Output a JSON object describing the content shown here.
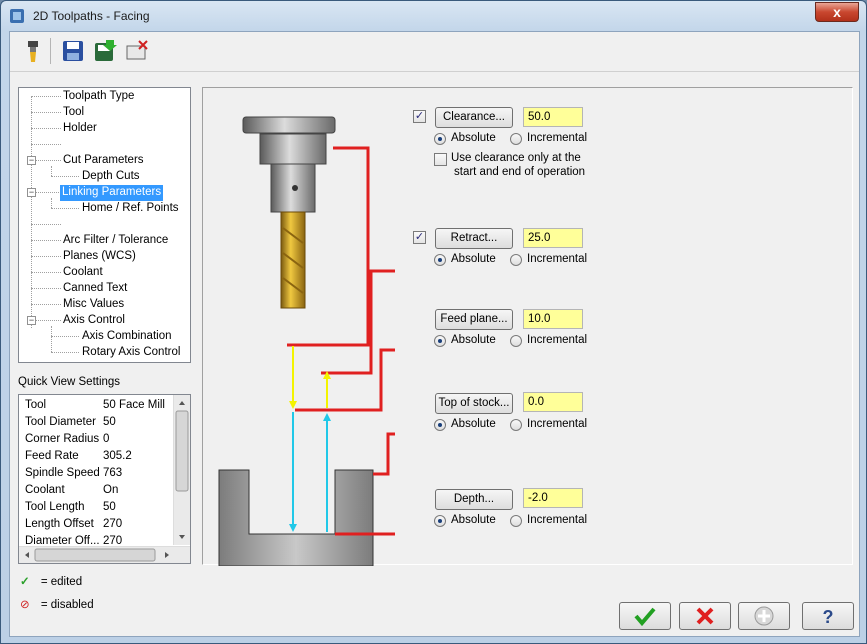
{
  "window": {
    "title": "2D Toolpaths - Facing",
    "close_symbol": "x"
  },
  "toolbar": {
    "icons": [
      "tool-icon",
      "save-icon",
      "save-to-library-icon",
      "disable-icon"
    ]
  },
  "tree": {
    "items": [
      {
        "label": "Toolpath Type"
      },
      {
        "label": "Tool"
      },
      {
        "label": "Holder"
      },
      {
        "label": ""
      },
      {
        "label": "Cut Parameters"
      },
      {
        "label": "Depth Cuts"
      },
      {
        "label": "Linking Parameters"
      },
      {
        "label": "Home / Ref. Points"
      },
      {
        "label": ""
      },
      {
        "label": "Arc Filter / Tolerance"
      },
      {
        "label": "Planes (WCS)"
      },
      {
        "label": "Coolant"
      },
      {
        "label": "Canned Text"
      },
      {
        "label": "Misc Values"
      },
      {
        "label": "Axis Control"
      },
      {
        "label": "Axis Combination"
      },
      {
        "label": "Rotary Axis Control"
      }
    ]
  },
  "quick_view": {
    "label": "Quick View Settings",
    "rows": [
      {
        "k": "Tool",
        "v": "50 Face Mill"
      },
      {
        "k": "Tool Diameter",
        "v": "50"
      },
      {
        "k": "Corner Radius",
        "v": "0"
      },
      {
        "k": "Feed Rate",
        "v": "305.2"
      },
      {
        "k": "Spindle Speed",
        "v": "763"
      },
      {
        "k": "Coolant",
        "v": "On"
      },
      {
        "k": "Tool Length",
        "v": "50"
      },
      {
        "k": "Length Offset",
        "v": "270"
      },
      {
        "k": "Diameter Off...",
        "v": "270"
      }
    ]
  },
  "legend": {
    "edited": "= edited",
    "disabled": "= disabled"
  },
  "params": {
    "clearance": {
      "label": "Clearance...",
      "value": "50.0",
      "checked": true
    },
    "clearance_note_1": "Use clearance only at the",
    "clearance_note_2": "start and end of operation",
    "retract": {
      "label": "Retract...",
      "value": "25.0",
      "checked": true
    },
    "feed_plane": {
      "label": "Feed plane...",
      "value": "10.0"
    },
    "top_of_stock": {
      "label": "Top of stock...",
      "value": "0.0"
    },
    "depth": {
      "label": "Depth...",
      "value": "-2.0"
    },
    "absolute": "Absolute",
    "incremental": "Incremental"
  },
  "colors": {
    "field_bg": "#ffff99",
    "tool_gold": "#d4a017",
    "red_line": "#e02020",
    "yellow_arrow": "#f4f400",
    "cyan_arrow": "#20c8e8",
    "ok_green": "#22a022",
    "cancel_red": "#e02020"
  },
  "buttons": [
    "ok-icon",
    "cancel-icon",
    "add-icon",
    "help-icon"
  ]
}
